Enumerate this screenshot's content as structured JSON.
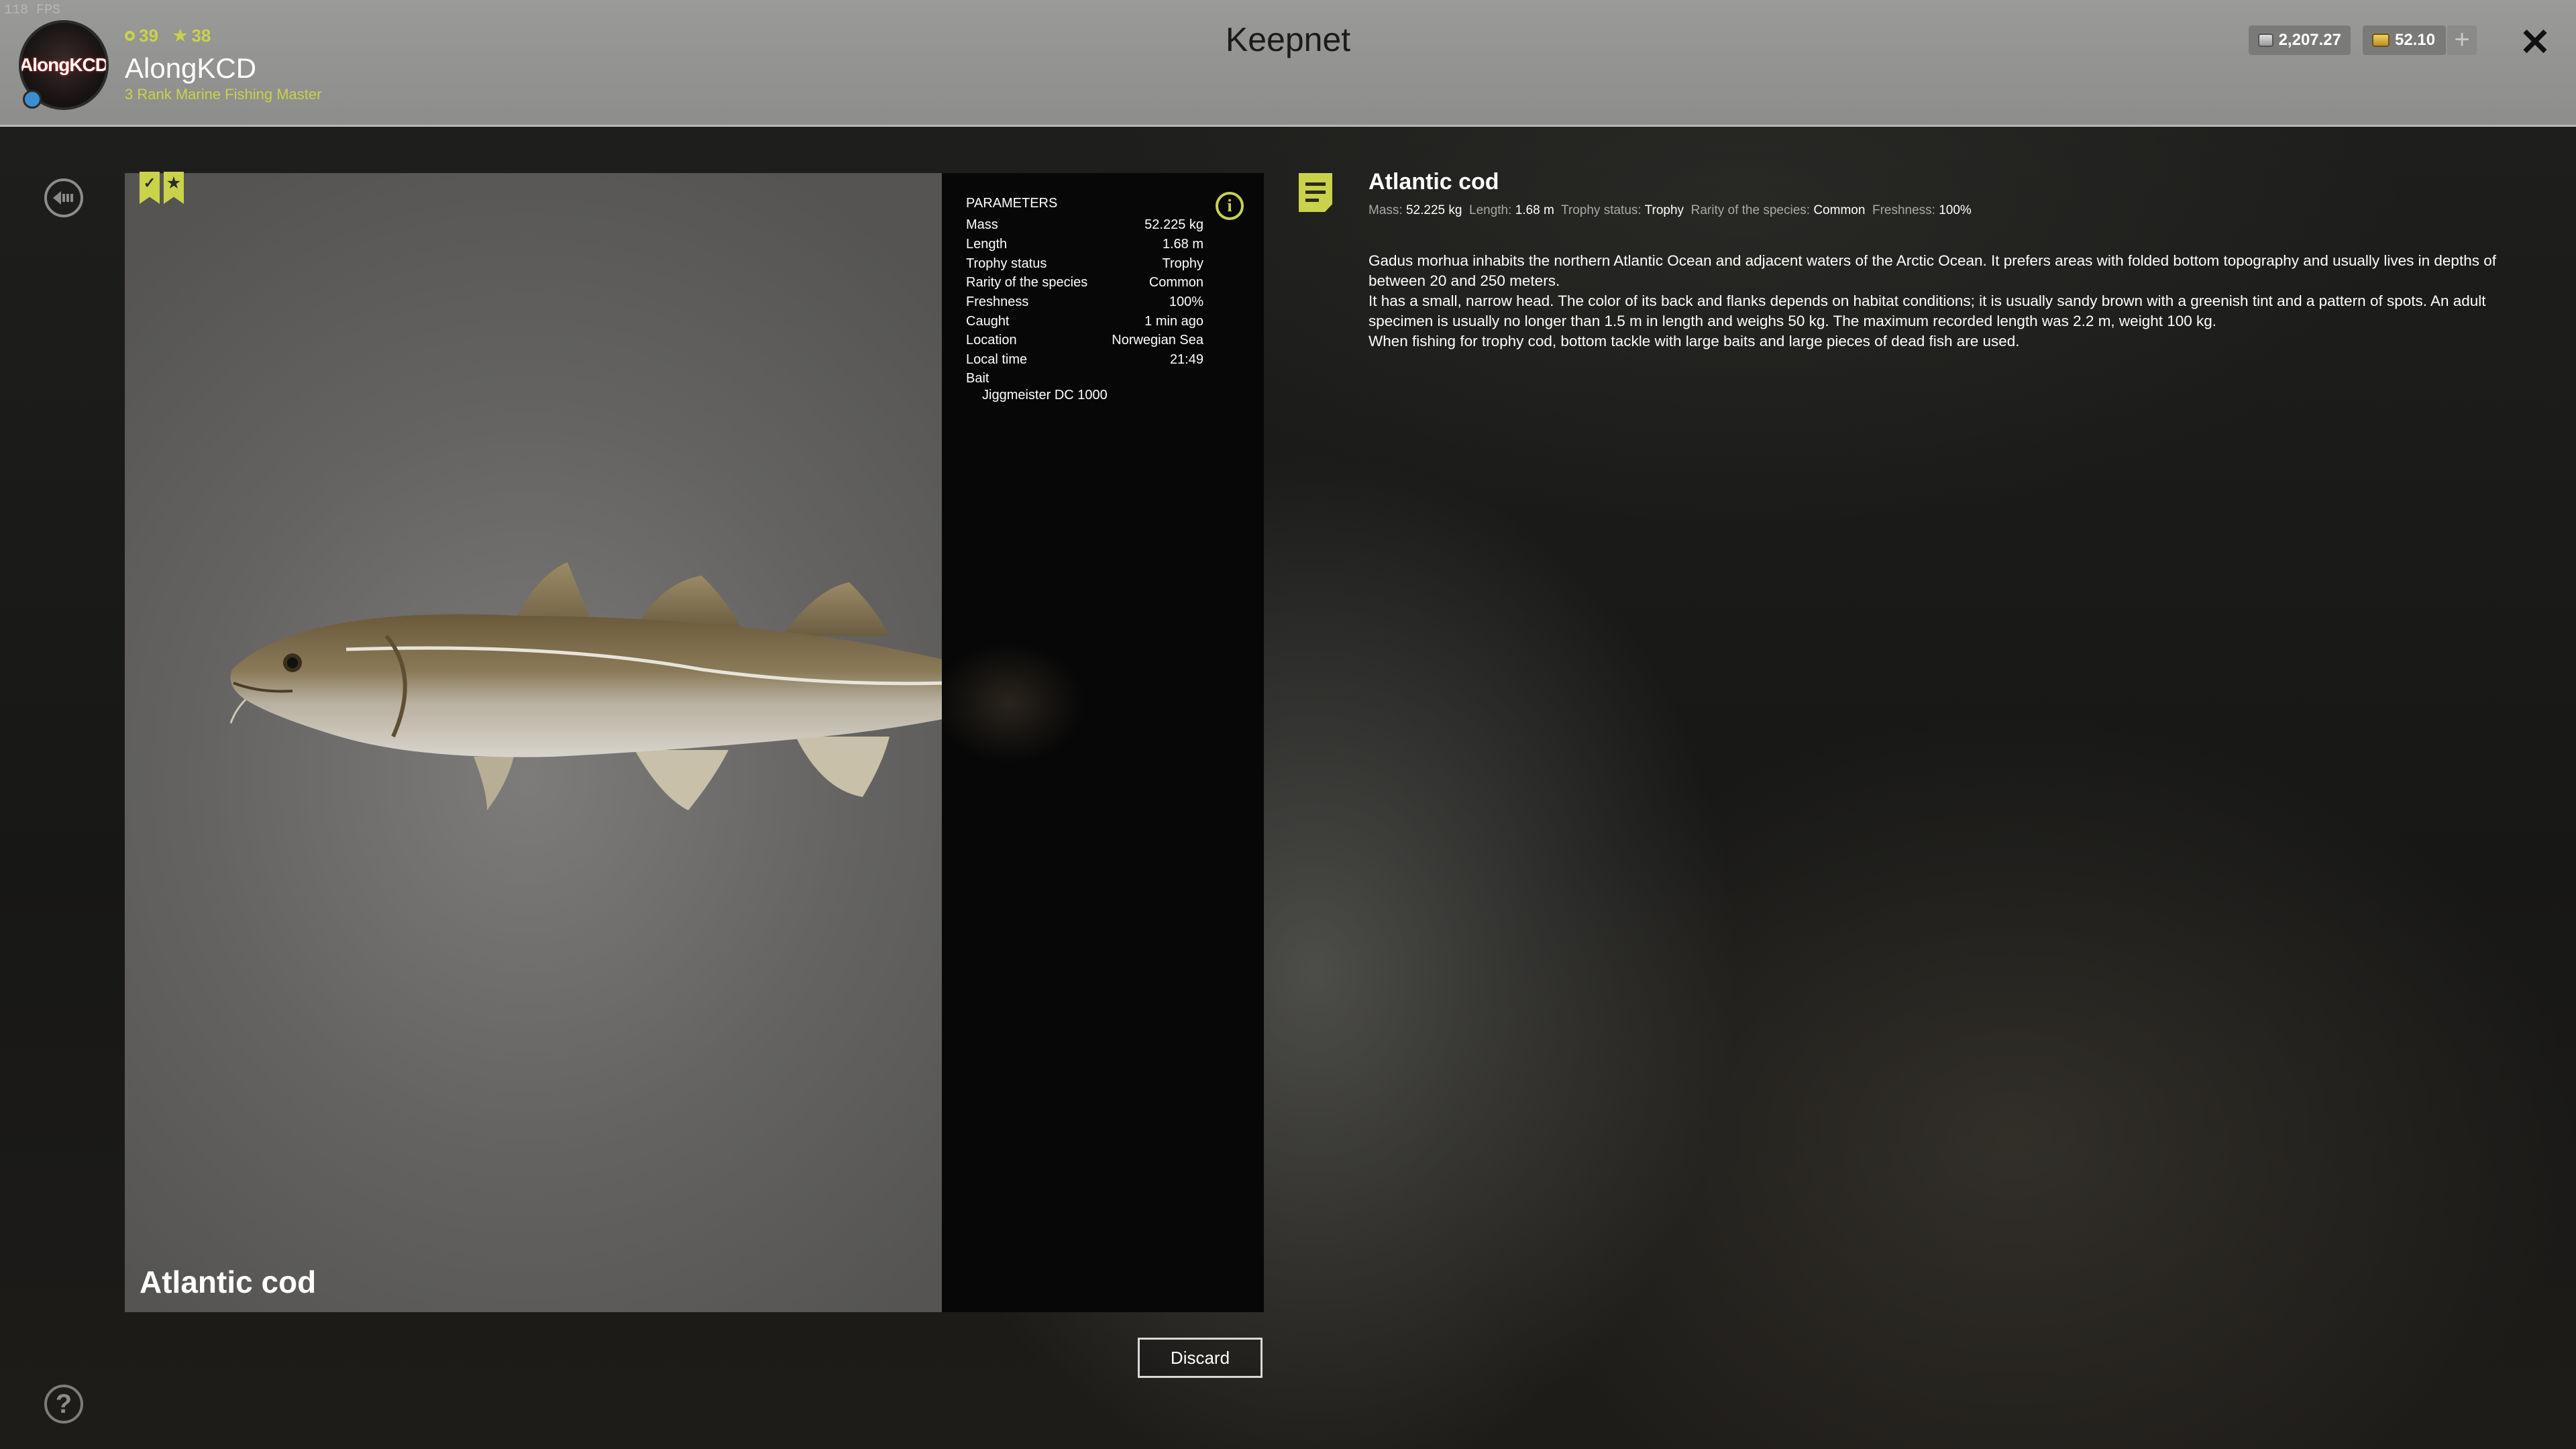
{
  "fps": "118 FPS",
  "player": {
    "avatar_text": "AlongKCD",
    "level": "39",
    "stars": "38",
    "name": "AlongKCD",
    "rank": "3 Rank Marine Fishing Master"
  },
  "header": {
    "title": "Keepnet",
    "silver": "2,207.27",
    "gold": "52.10"
  },
  "fish": {
    "name": "Atlantic cod"
  },
  "parameters": {
    "heading": "PARAMETERS",
    "rows": [
      {
        "label": "Mass",
        "value": "52.225 kg"
      },
      {
        "label": "Length",
        "value": "1.68 m"
      },
      {
        "label": "Trophy status",
        "value": "Trophy"
      },
      {
        "label": "Rarity of the species",
        "value": "Common"
      },
      {
        "label": "Freshness",
        "value": "100%"
      },
      {
        "label": "Caught",
        "value": "1 min ago"
      },
      {
        "label": "Location",
        "value": "Norwegian Sea"
      },
      {
        "label": "Local time",
        "value": "21:49"
      }
    ],
    "bait_label": "Bait",
    "bait_value": "Jiggmeister DC 1000"
  },
  "actions": {
    "discard_label": "Discard"
  },
  "description": {
    "title": "Atlantic cod",
    "summary": {
      "mass_label": "Mass:",
      "mass": "52.225 kg",
      "length_label": "Length:",
      "length": "1.68 m",
      "trophy_label": "Trophy status:",
      "trophy": "Trophy",
      "rarity_label": "Rarity of the species:",
      "rarity": "Common",
      "freshness_label": "Freshness:",
      "freshness": "100%"
    },
    "paragraphs": [
      "Gadus morhua inhabits the northern Atlantic Ocean and adjacent waters of the Arctic Ocean. It prefers areas with folded bottom topography and usually lives in depths of between 20 and 250 meters.",
      "It has a small, narrow head. The color of its back and flanks depends on habitat conditions; it is usually sandy brown with a greenish tint and a pattern of spots. An adult specimen is usually no longer than 1.5 m in length and weighs 50 kg. The maximum recorded length was 2.2 m, weight 100 kg.",
      "When fishing for trophy cod, bottom tackle with large baits and large pieces of dead fish are used."
    ]
  },
  "icons": {
    "back": "back-arrow-icon",
    "help": "help-icon",
    "close": "close-icon",
    "info": "info-icon",
    "note": "note-icon",
    "bookmarks": [
      "check-bookmark-icon",
      "star-bookmark-icon"
    ]
  },
  "colors": {
    "accent": "#c9d24a",
    "topbar": "#9a9a98",
    "panel": "#070707"
  }
}
